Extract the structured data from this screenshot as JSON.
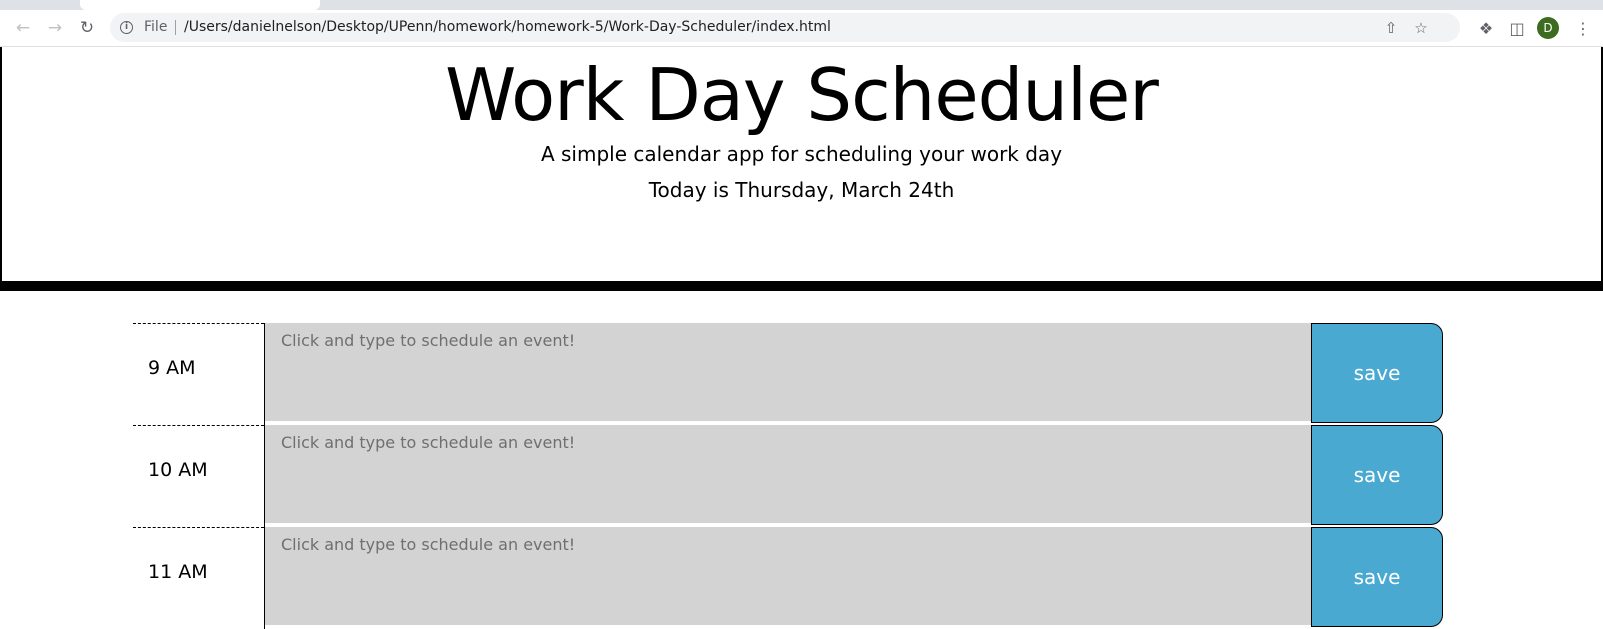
{
  "browser": {
    "scheme": "File",
    "url": "/Users/danielnelson/Desktop/UPenn/homework/homework-5/Work-Day-Scheduler/index.html",
    "profile_initial": "D",
    "icons": {
      "back": "back-arrow-icon",
      "forward": "forward-arrow-icon",
      "reload": "reload-icon",
      "info": "info-icon",
      "share": "share-icon",
      "bookmark": "star-icon",
      "extensions": "puzzle-icon",
      "side_panel": "side-panel-icon",
      "menu": "kebab-menu-icon"
    }
  },
  "header": {
    "title": "Work Day Scheduler",
    "subtitle": "A simple calendar app for scheduling your work day",
    "today": "Today is Thursday, March 24th"
  },
  "colors": {
    "past_block": "#d3d3d3",
    "save_button": "#4aa9d1",
    "profile_avatar": "#3d6b1f"
  },
  "time_blocks": [
    {
      "hour": "9 AM",
      "placeholder": "Click and type to schedule an event!",
      "value": "",
      "save_label": "save"
    },
    {
      "hour": "10 AM",
      "placeholder": "Click and type to schedule an event!",
      "value": "",
      "save_label": "save"
    },
    {
      "hour": "11 AM",
      "placeholder": "Click and type to schedule an event!",
      "value": "",
      "save_label": "save"
    }
  ]
}
